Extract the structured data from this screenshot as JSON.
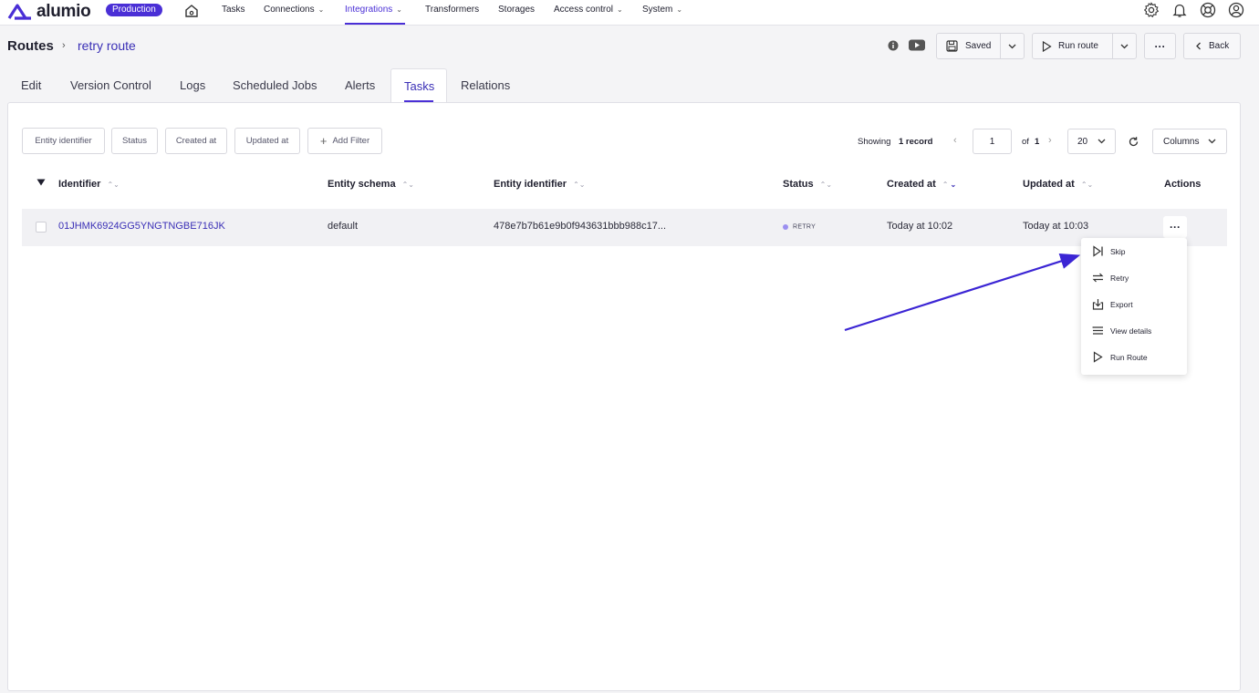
{
  "brand": {
    "name": "alumio",
    "accent": "#4a2fd6"
  },
  "topnav": {
    "environment": "Production",
    "items": [
      {
        "label": "Tasks",
        "has_dropdown": false
      },
      {
        "label": "Connections",
        "has_dropdown": true
      },
      {
        "label": "Integrations",
        "has_dropdown": true,
        "active": true
      },
      {
        "label": "Transformers",
        "has_dropdown": false
      },
      {
        "label": "Storages",
        "has_dropdown": false
      },
      {
        "label": "Access control",
        "has_dropdown": true
      },
      {
        "label": "System",
        "has_dropdown": true
      }
    ],
    "icons": [
      "settings-icon",
      "bell-icon",
      "support-icon",
      "user-account-icon"
    ]
  },
  "header": {
    "breadcrumb_root": "Routes",
    "breadcrumb_current": "retry route",
    "saved_label": "Saved",
    "run_label": "Run route",
    "back_label": "Back"
  },
  "tabs": [
    {
      "label": "Edit"
    },
    {
      "label": "Version Control"
    },
    {
      "label": "Logs"
    },
    {
      "label": "Scheduled Jobs"
    },
    {
      "label": "Alerts"
    },
    {
      "label": "Tasks",
      "active": true
    },
    {
      "label": "Relations"
    }
  ],
  "filters": {
    "chips": [
      "Entity identifier",
      "Status",
      "Created at",
      "Updated at"
    ],
    "add_filter": "Add Filter"
  },
  "pager": {
    "showing_label": "Showing",
    "showing_count": "1 record",
    "page": "1",
    "of_label": "of",
    "total_pages": "1",
    "page_size": "20",
    "columns_label": "Columns"
  },
  "table": {
    "headers": [
      "Identifier",
      "Entity schema",
      "Entity identifier",
      "Status",
      "Created at",
      "Updated at",
      "Actions"
    ],
    "rows": [
      {
        "identifier": "01JHMK6924GG5YNGTNGBE716JK",
        "entity_schema": "default",
        "entity_identifier": "478e7b7b61e9b0f943631bbb988c17...",
        "status": "RETRY",
        "created_at": "Today at 10:02",
        "updated_at": "Today at 10:03"
      }
    ]
  },
  "actions_menu": {
    "items": [
      {
        "label": "Skip",
        "icon": "skip-icon"
      },
      {
        "label": "Retry",
        "icon": "retry-icon"
      },
      {
        "label": "Export",
        "icon": "export-icon"
      },
      {
        "label": "View details",
        "icon": "list-icon"
      },
      {
        "label": "Run Route",
        "icon": "play-icon"
      }
    ]
  },
  "annotation": {
    "arrow_color": "#3b25d4"
  }
}
